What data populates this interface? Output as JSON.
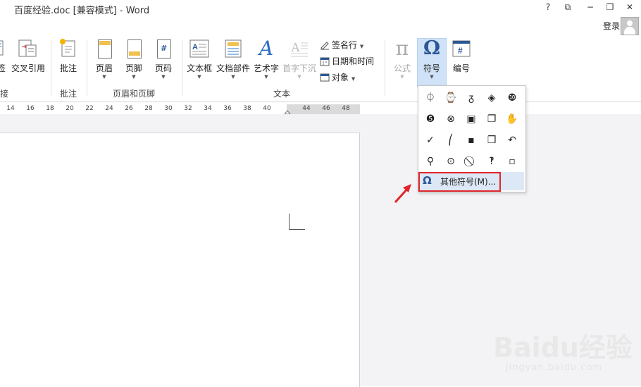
{
  "titlebar": {
    "title": "百度经验.doc [兼容模式] - Word",
    "help": "?",
    "ribbon_display": "⧉",
    "minimize": "−",
    "restore": "❐",
    "close": "✕",
    "login": "登录"
  },
  "ribbon": {
    "partial_left": {
      "label1": "签",
      "label2": "交叉引用",
      "group": "接"
    },
    "comment": {
      "label": "批注",
      "group": "批注"
    },
    "header_footer": {
      "header": "页眉",
      "footer": "页脚",
      "page_number": "页码",
      "group": "页眉和页脚"
    },
    "text": {
      "textbox": "文本框",
      "quick_parts": "文档部件",
      "wordart": "艺术字",
      "dropcap": "首字下沉",
      "signature": "签名行",
      "datetime": "日期和时间",
      "object": "对象",
      "group": "文本"
    },
    "symbols": {
      "equation": "公式",
      "symbol": "符号",
      "numbering": "编号"
    }
  },
  "ruler": {
    "ticks": [
      "14",
      "16",
      "18",
      "20",
      "22",
      "24",
      "26",
      "28",
      "30",
      "32",
      "34",
      "36",
      "38",
      "40",
      "44",
      "46",
      "48"
    ]
  },
  "symbol_dropdown": {
    "rows": [
      [
        "⏀",
        "⌚",
        "ᵹ",
        "◈",
        "❿"
      ],
      [
        "❺",
        "⊗",
        "▣",
        "❐",
        "✋"
      ],
      [
        "✓",
        "⎛",
        "▪",
        "❒",
        "↶"
      ],
      [
        "⚲",
        "⊙",
        "⃠",
        "‽",
        "▫"
      ]
    ],
    "more_symbols": "其他符号(M)..."
  },
  "watermark": {
    "brand": "Baidu经验",
    "url": "jingyan.baidu.com"
  },
  "colors": {
    "accent": "#2b5797",
    "selected_bg": "#cfe2f7",
    "highlight_box": "#e0262b"
  }
}
